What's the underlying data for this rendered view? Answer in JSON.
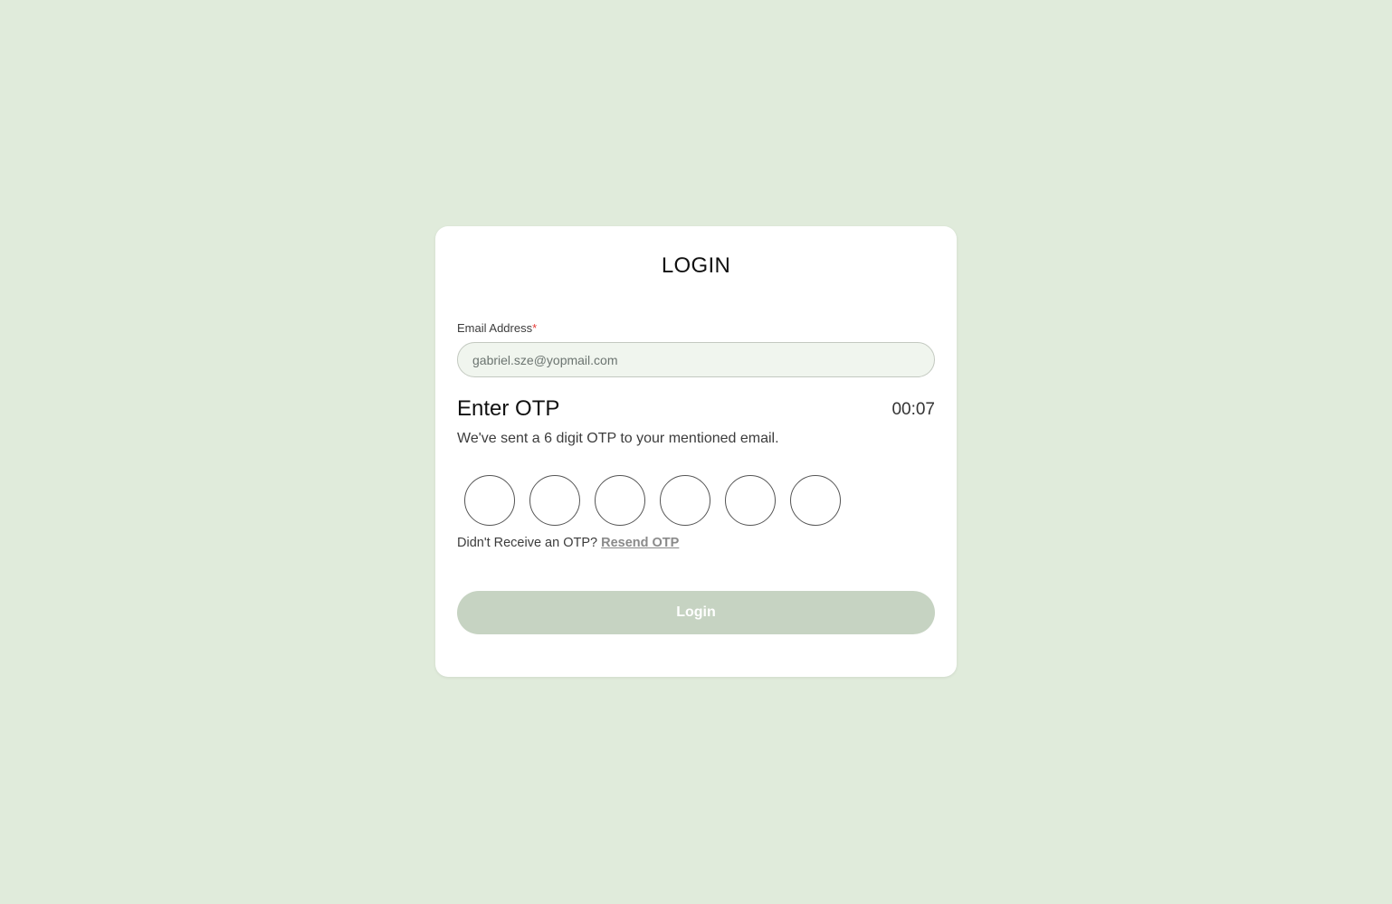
{
  "login": {
    "title": "LOGIN",
    "email": {
      "label": "Email Address",
      "required_marker": "*",
      "value": "gabriel.sze@yopmail.com"
    },
    "otp": {
      "heading": "Enter OTP",
      "timer": "00:07",
      "description": "We've sent a 6 digit OTP to your mentioned email.",
      "digits": [
        "",
        "",
        "",
        "",
        "",
        ""
      ]
    },
    "resend": {
      "prompt": "Didn't Receive an OTP?",
      "link_label": "Resend OTP"
    },
    "submit_label": "Login"
  },
  "colors": {
    "page_background": "#e0ebdb",
    "card_background": "#ffffff",
    "input_background": "#f0f5ee",
    "button_disabled": "#c6d3c2",
    "required_marker": "#e53935"
  }
}
